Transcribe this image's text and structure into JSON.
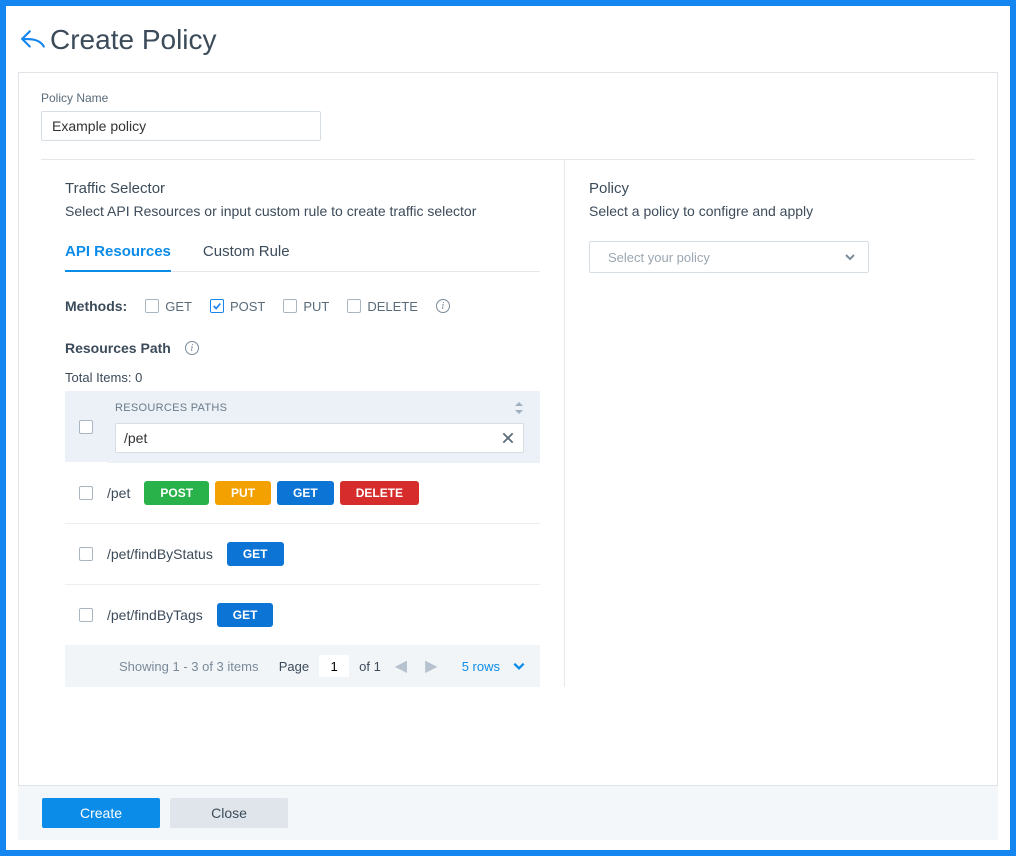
{
  "header": {
    "title": "Create Policy"
  },
  "policy_name": {
    "label": "Policy Name",
    "value": "Example policy"
  },
  "traffic_selector": {
    "title": "Traffic Selector",
    "subtitle": "Select API Resources or input custom rule to create traffic selector",
    "tabs": {
      "api_resources": "API Resources",
      "custom_rule": "Custom Rule"
    },
    "methods_label": "Methods:",
    "methods": {
      "get": {
        "label": "GET",
        "checked": false
      },
      "post": {
        "label": "POST",
        "checked": true
      },
      "put": {
        "label": "PUT",
        "checked": false
      },
      "delete": {
        "label": "DELETE",
        "checked": false
      }
    },
    "resources_path_label": "Resources Path",
    "total_items": "Total Items: 0",
    "column_header": "RESOURCES PATHS",
    "filter_value": "/pet",
    "rows": [
      {
        "path": "/pet",
        "methods": [
          "POST",
          "PUT",
          "GET",
          "DELETE"
        ]
      },
      {
        "path": "/pet/findByStatus",
        "methods": [
          "GET"
        ]
      },
      {
        "path": "/pet/findByTags",
        "methods": [
          "GET"
        ]
      }
    ],
    "pagination": {
      "showing": "Showing 1 - 3 of 3 items",
      "page_label": "Page",
      "page_value": "1",
      "of_label": "of 1",
      "rows_label": "5 rows"
    }
  },
  "policy_panel": {
    "title": "Policy",
    "subtitle": "Select a policy to configre and apply",
    "select_placeholder": "Select your policy"
  },
  "footer": {
    "create": "Create",
    "close": "Close"
  }
}
